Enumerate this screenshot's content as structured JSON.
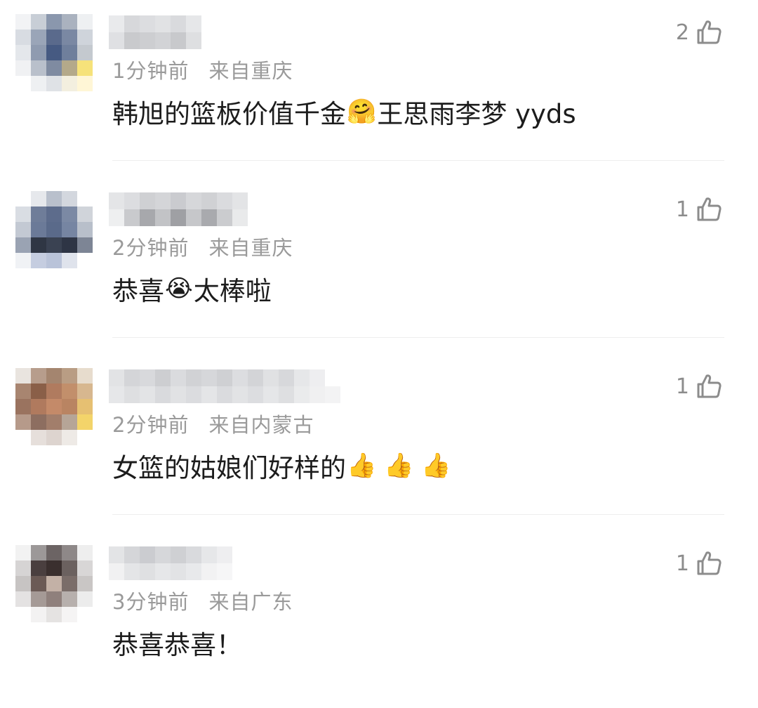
{
  "comments": [
    {
      "time": "1分钟前",
      "location": "来自重庆",
      "likes": "2",
      "text_before": "韩旭的篮板价值千金",
      "emoji": "🤗",
      "text_after": "王思雨李梦 yyds"
    },
    {
      "time": "2分钟前",
      "location": "来自重庆",
      "likes": "1",
      "text_before": "恭喜",
      "emoji": "😭",
      "text_after": "太棒啦"
    },
    {
      "time": "2分钟前",
      "location": "来自内蒙古",
      "likes": "1",
      "text_before": "女篮的姑娘们好样的",
      "emoji": "👍 👍 👍",
      "text_after": ""
    },
    {
      "time": "3分钟前",
      "location": "来自广东",
      "likes": "1",
      "text_before": "恭喜恭喜！",
      "emoji": "",
      "text_after": ""
    }
  ]
}
